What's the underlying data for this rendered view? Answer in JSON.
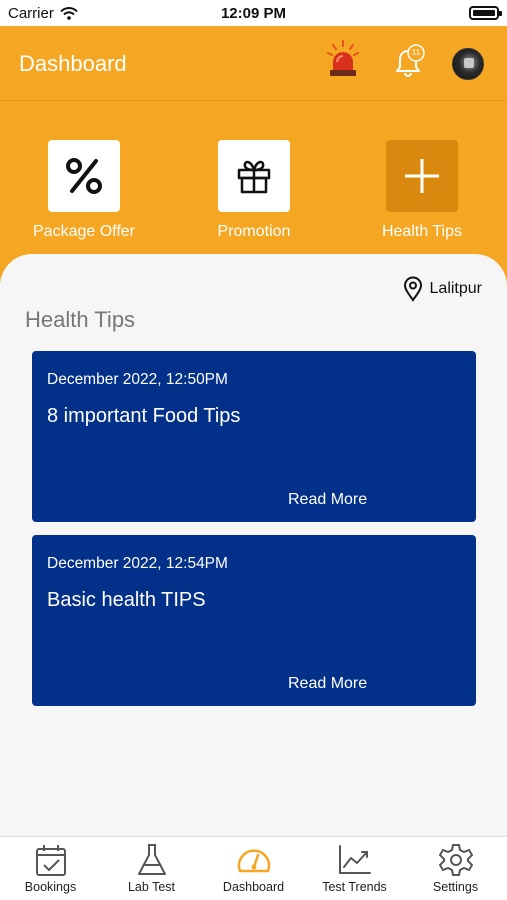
{
  "status_bar": {
    "carrier": "Carrier",
    "time": "12:09 PM"
  },
  "header": {
    "title": "Dashboard",
    "notification_count": "11",
    "accent_color": "#f5a623"
  },
  "quick_actions": [
    {
      "label": "Package Offer",
      "icon": "percent-icon"
    },
    {
      "label": "Promotion",
      "icon": "gift-icon"
    },
    {
      "label": "Health Tips",
      "icon": "plus-icon"
    }
  ],
  "location": "Lalitpur",
  "section_title": "Health Tips",
  "tips": [
    {
      "date": "December 2022, 12:50PM",
      "title": "8 important Food Tips",
      "action": "Read More"
    },
    {
      "date": "December 2022, 12:54PM",
      "title": "Basic health TIPS",
      "action": "Read More"
    }
  ],
  "card_color": "#03318a",
  "tabs": [
    {
      "label": "Bookings",
      "icon": "calendar-check-icon"
    },
    {
      "label": "Lab Test",
      "icon": "flask-icon"
    },
    {
      "label": "Dashboard",
      "icon": "gauge-icon",
      "active": true
    },
    {
      "label": "Test Trends",
      "icon": "trend-chart-icon"
    },
    {
      "label": "Settings",
      "icon": "gear-icon"
    }
  ]
}
